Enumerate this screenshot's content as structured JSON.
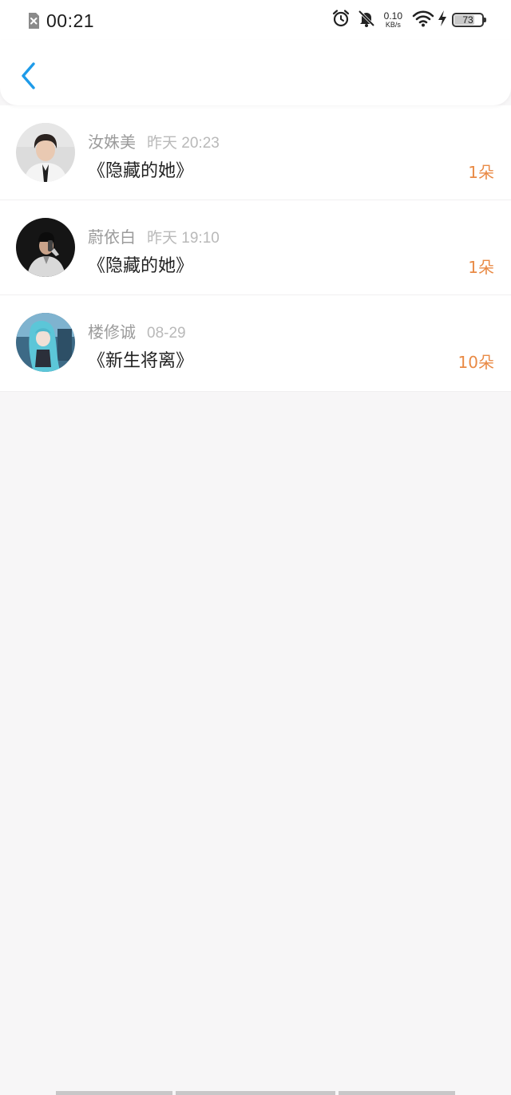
{
  "status_bar": {
    "time": "00:21",
    "net_speed_value": "0.10",
    "net_speed_unit": "KB/s",
    "battery_level": "73",
    "icons": [
      "sim-disabled-icon",
      "alarm-icon",
      "bell-muted-icon",
      "wifi-icon",
      "charging-bolt-icon",
      "battery-icon"
    ]
  },
  "header": {
    "back_icon": "chevron-left-icon"
  },
  "records": [
    {
      "name": "汝姝美",
      "time": "昨天 20:23",
      "title": "《隐藏的她》",
      "flowers": "1朵"
    },
    {
      "name": "蔚依白",
      "time": "昨天 19:10",
      "title": "《隐藏的她》",
      "flowers": "1朵"
    },
    {
      "name": "楼修诚",
      "time": "08-29",
      "title": "《新生将离》",
      "flowers": "10朵"
    }
  ],
  "colors": {
    "accent_blue": "#1e9be9",
    "flower_orange": "#e98a45",
    "background": "#f7f6f7"
  }
}
